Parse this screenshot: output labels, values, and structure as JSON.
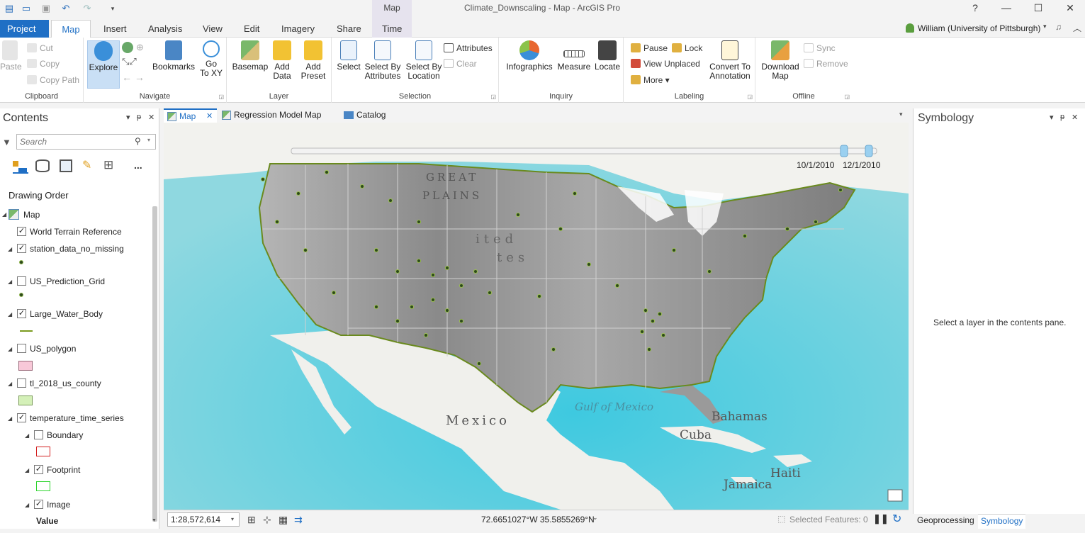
{
  "window": {
    "title": "Climate_Downscaling - Map - ArcGIS Pro",
    "user": "William (University of Pittsburgh)",
    "help_label": "?",
    "minimize_label": "—",
    "maximize_label": "☐",
    "close_label": "✕",
    "bell_label": "🔔",
    "qat": [
      "new",
      "open",
      "save",
      "undo",
      "redo",
      "customize"
    ]
  },
  "ribbon_tabs": {
    "project": "Project",
    "map": "Map",
    "insert": "Insert",
    "analysis": "Analysis",
    "view": "View",
    "edit": "Edit",
    "imagery": "Imagery",
    "share": "Share",
    "contextual_group": "Map",
    "time": "Time"
  },
  "clipboard": {
    "label": "Clipboard",
    "paste": "Paste",
    "cut": "Cut",
    "copy": "Copy",
    "copy_path": "Copy Path"
  },
  "navigate": {
    "label": "Navigate",
    "explore": "Explore",
    "bookmarks": "Bookmarks",
    "goto_line1": "Go",
    "goto_line2": "To XY"
  },
  "layer": {
    "label": "Layer",
    "basemap": "Basemap",
    "add_data_line1": "Add",
    "add_data_line2": "Data",
    "add_preset_line1": "Add",
    "add_preset_line2": "Preset"
  },
  "selection": {
    "label": "Selection",
    "select": "Select",
    "select_by_attr_line1": "Select By",
    "select_by_attr_line2": "Attributes",
    "select_by_loc_line1": "Select By",
    "select_by_loc_line2": "Location",
    "attributes": "Attributes",
    "clear": "Clear"
  },
  "inquiry": {
    "label": "Inquiry",
    "infographics": "Infographics",
    "measure": "Measure",
    "locate": "Locate"
  },
  "labeling": {
    "label": "Labeling",
    "pause": "Pause",
    "lock": "Lock",
    "view_unplaced": "View Unplaced",
    "more": "More",
    "convert_line1": "Convert To",
    "convert_line2": "Annotation"
  },
  "offline": {
    "label": "Offline",
    "download_line1": "Download",
    "download_line2": "Map",
    "sync": "Sync",
    "remove": "Remove"
  },
  "contents": {
    "title": "Contents",
    "search_placeholder": "Search",
    "drawing_order": "Drawing Order",
    "map_node": "Map",
    "layers": [
      {
        "name": "World Terrain Reference",
        "checked": true
      },
      {
        "name": "station_data_no_missing",
        "checked": true
      },
      {
        "name": "US_Prediction_Grid",
        "checked": false
      },
      {
        "name": "Large_Water_Body",
        "checked": true
      },
      {
        "name": "US_polygon",
        "checked": false
      },
      {
        "name": "tl_2018_us_county",
        "checked": false
      },
      {
        "name": "temperature_time_series",
        "checked": true
      },
      {
        "name": "Boundary",
        "checked": false
      },
      {
        "name": "Footprint",
        "checked": true
      },
      {
        "name": "Image",
        "checked": true
      }
    ],
    "value_label": "Value",
    "more_label": "..."
  },
  "view_tabs": {
    "map": "Map",
    "regression": "Regression Model Map",
    "catalog": "Catalog"
  },
  "map": {
    "time_start": "10/1/2010",
    "time_end": "12/1/2010",
    "labels": {
      "great": "GREAT",
      "plains": "PLAINS",
      "united": "ited",
      "states": "tes",
      "gulf": "Gulf of Mexico",
      "mexico": "Mexico",
      "bahamas": "Bahamas",
      "cuba": "Cuba",
      "haiti": "Haiti",
      "jamaica": "Jamaica"
    }
  },
  "status": {
    "scale": "1:28,572,614",
    "coords": "72.6651027°W 35.5855269°N",
    "selected_features": "Selected Features: 0"
  },
  "symbology": {
    "title": "Symbology",
    "message": "Select a layer in the contents pane.",
    "bottom_tabs": {
      "geoprocessing": "Geoprocessing",
      "symbology": "Symbology"
    }
  },
  "colors": {
    "accent": "#1f6fc5",
    "ocean": "#6fcad8",
    "station": "#2d4a1c",
    "water_body": "#7a9a1e"
  }
}
